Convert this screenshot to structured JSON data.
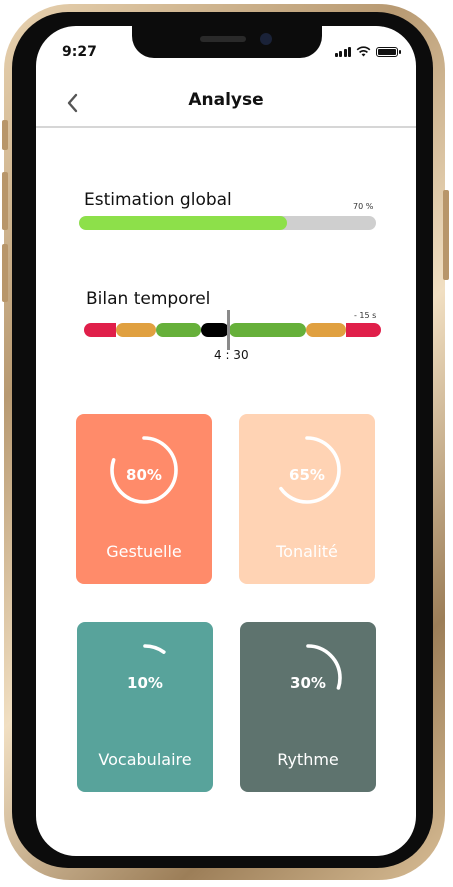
{
  "status_bar": {
    "time": "9:27"
  },
  "header": {
    "title": "Analyse",
    "back_icon": "chevron-left-icon"
  },
  "estimation": {
    "label": "Estimation global",
    "value_text": "70 %",
    "value": 0.7,
    "fill_color": "#8de04a"
  },
  "bilan": {
    "label": "Bilan temporel",
    "offset_text": "- 15 s",
    "cursor_time": "4 : 30",
    "segments": [
      {
        "color": "#e01f4a"
      },
      {
        "color": "#e0a040"
      },
      {
        "color": "#66b03a"
      },
      {
        "color": "#000000"
      },
      {
        "color": "#66b03a"
      },
      {
        "color": "#e0a040"
      },
      {
        "color": "#e01f4a"
      }
    ]
  },
  "cards": [
    {
      "name": "Gestuelle",
      "percent_text": "80%",
      "value": 0.8,
      "color": "#ff8b6a"
    },
    {
      "name": "Tonalité",
      "percent_text": "65%",
      "value": 0.65,
      "color": "#ffd3b4"
    },
    {
      "name": "Vocabulaire",
      "percent_text": "10%",
      "value": 0.1,
      "color": "#58a39b"
    },
    {
      "name": "Rythme",
      "percent_text": "30%",
      "value": 0.3,
      "color": "#5e736e"
    }
  ]
}
